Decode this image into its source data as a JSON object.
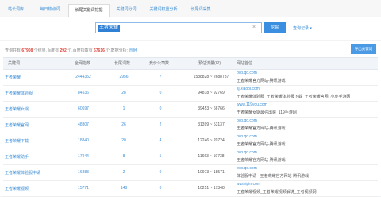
{
  "tabs": [
    {
      "label": "站长词库",
      "active": false
    },
    {
      "label": "每日热点词",
      "active": false
    },
    {
      "label": "长尾关键词挖掘",
      "active": true
    },
    {
      "label": "关键词分词",
      "active": false
    },
    {
      "label": "关键词权重分析",
      "active": false
    },
    {
      "label": "长尾词采集",
      "active": false
    }
  ],
  "search": {
    "value": "王者荣耀",
    "button": "挖掘",
    "history": "查询记录 ▾"
  },
  "summary": {
    "p1": "查询共有 ",
    "total": "67908",
    "p2": " 个结果,百度有 ",
    "baidu": "292",
    "p3": " 个,百度指数有 ",
    "index": "67616",
    "p4": " 个,数据分析: ",
    "link": "示例"
  },
  "export_button": "导出关键词",
  "table": {
    "headers": [
      "关键词",
      "全网指数",
      "长尾词数",
      "竞价公司数",
      "预估流量(IP)",
      "网站首位"
    ],
    "rows": [
      {
        "keyword": "王者荣耀",
        "index": "2444352",
        "longtail": "2956",
        "bid": "7",
        "traffic": "1588828 ~ 2688787",
        "url": "pvp.qq.com",
        "site": "王者荣耀官方网站-腾讯游戏"
      },
      {
        "keyword": "王者荣耀体验服",
        "index": "84536",
        "longtail": "28",
        "bid": "0",
        "traffic": "94818 ~ 92769",
        "url": "sj.xiaopi.com",
        "site": "王者荣耀体验服_王者荣耀体验服下载_王者荣耀官网_小皮手游网"
      },
      {
        "keyword": "王者荣耀女娲",
        "index": "60697",
        "longtail": "1",
        "bid": "0",
        "traffic": "39453 ~ 66766",
        "url": "www.119you.com",
        "site": "王者荣耀女娲最强出装_119手游网"
      },
      {
        "keyword": "王者荣耀官网",
        "index": "48307",
        "longtail": "26",
        "bid": "2",
        "traffic": "31399 ~ 53137",
        "url": "pvp.qq.com",
        "site": "王者荣耀官方网站-腾讯游戏"
      },
      {
        "keyword": "王者荣耀下载",
        "index": "18840",
        "longtail": "20",
        "bid": "4",
        "traffic": "12246 ~ 20724",
        "url": "pvp.qq.com",
        "site": "王者荣耀官方网站-腾讯游戏"
      },
      {
        "keyword": "王者荣耀助手",
        "index": "17944",
        "longtail": "8",
        "bid": "5",
        "traffic": "11663 ~ 19738",
        "url": "pvp.qq.com",
        "site": "王者荣耀官方网站-腾讯游戏"
      },
      {
        "keyword": "王者荣耀体验服申请",
        "index": "16883",
        "longtail": "2",
        "bid": "0",
        "traffic": "10973 ~ 18571",
        "url": "pvp.qq.com",
        "site": "体验服申请 - 王者荣耀官方网站-腾讯游戏"
      },
      {
        "keyword": "王者荣耀视频",
        "index": "15771",
        "longtail": "148",
        "bid": "0",
        "traffic": "10251 ~ 17348",
        "url": "wzshipin.com",
        "site": "王者荣耀视频_王者荣耀视频解说_王者视频网"
      }
    ]
  }
}
